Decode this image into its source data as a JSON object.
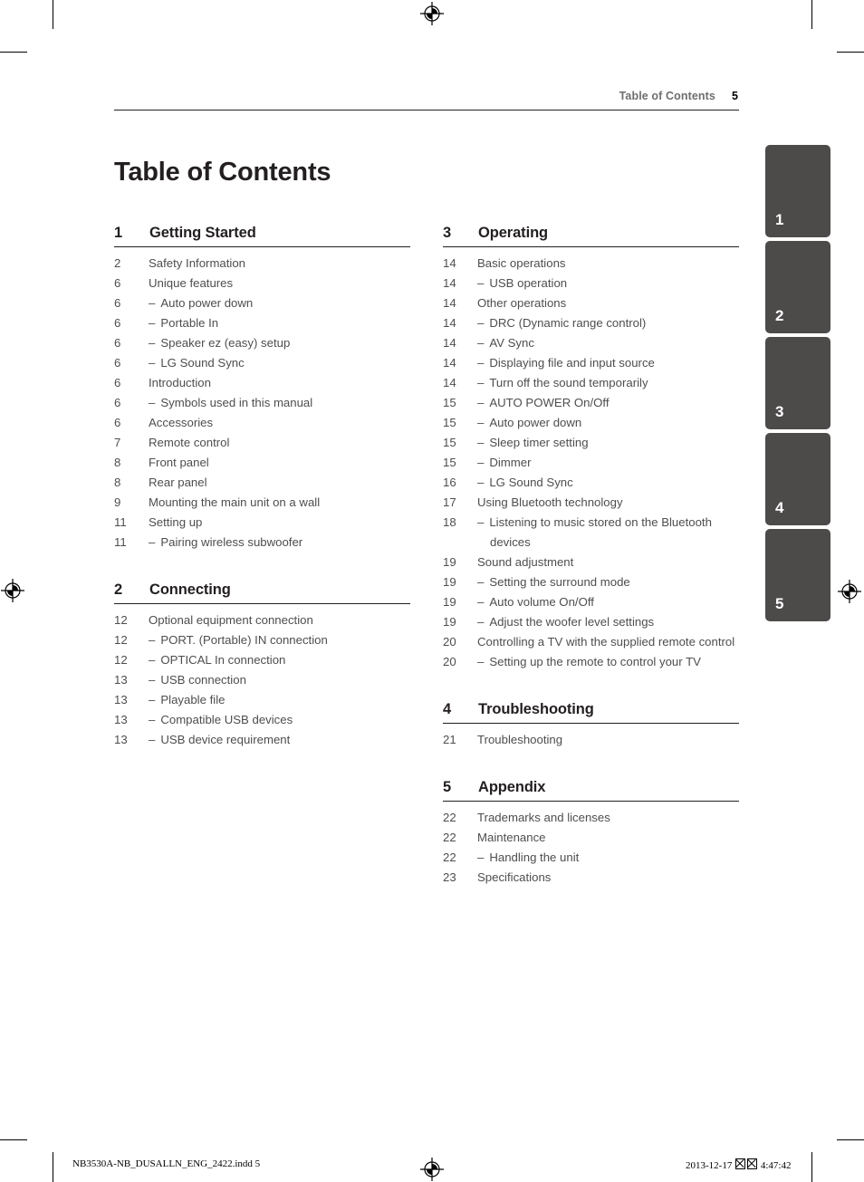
{
  "header": {
    "running_title": "Table of Contents",
    "page_number": "5"
  },
  "page_title": "Table of Contents",
  "columns": {
    "left": [
      {
        "number": "1",
        "title": "Getting Started",
        "entries": [
          {
            "page": "2",
            "label": "Safety Information",
            "sub": false
          },
          {
            "page": "6",
            "label": "Unique features",
            "sub": false
          },
          {
            "page": "6",
            "label": "Auto power down",
            "sub": true
          },
          {
            "page": "6",
            "label": "Portable In",
            "sub": true
          },
          {
            "page": "6",
            "label": "Speaker ez (easy) setup",
            "sub": true
          },
          {
            "page": "6",
            "label": "LG Sound Sync",
            "sub": true
          },
          {
            "page": "6",
            "label": "Introduction",
            "sub": false
          },
          {
            "page": "6",
            "label": "Symbols used in this manual",
            "sub": true
          },
          {
            "page": "6",
            "label": "Accessories",
            "sub": false
          },
          {
            "page": "7",
            "label": "Remote control",
            "sub": false
          },
          {
            "page": "8",
            "label": "Front panel",
            "sub": false
          },
          {
            "page": "8",
            "label": "Rear panel",
            "sub": false
          },
          {
            "page": "9",
            "label": "Mounting the main unit on a wall",
            "sub": false
          },
          {
            "page": "11",
            "label": "Setting up",
            "sub": false
          },
          {
            "page": "11",
            "label": "Pairing wireless subwoofer",
            "sub": true
          }
        ]
      },
      {
        "number": "2",
        "title": "Connecting",
        "entries": [
          {
            "page": "12",
            "label": "Optional equipment connection",
            "sub": false
          },
          {
            "page": "12",
            "label": "PORT. (Portable) IN connection",
            "sub": true
          },
          {
            "page": "12",
            "label": "OPTICAL In connection",
            "sub": true
          },
          {
            "page": "13",
            "label": "USB connection",
            "sub": true
          },
          {
            "page": "13",
            "label": "Playable file",
            "sub": true
          },
          {
            "page": "13",
            "label": "Compatible USB devices",
            "sub": true
          },
          {
            "page": "13",
            "label": "USB device requirement",
            "sub": true
          }
        ]
      }
    ],
    "right": [
      {
        "number": "3",
        "title": "Operating",
        "entries": [
          {
            "page": "14",
            "label": "Basic operations",
            "sub": false
          },
          {
            "page": "14",
            "label": "USB operation",
            "sub": true
          },
          {
            "page": "14",
            "label": "Other operations",
            "sub": false
          },
          {
            "page": "14",
            "label": "DRC (Dynamic range control)",
            "sub": true
          },
          {
            "page": "14",
            "label": "AV Sync",
            "sub": true
          },
          {
            "page": "14",
            "label": "Displaying file and input source",
            "sub": true
          },
          {
            "page": "14",
            "label": "Turn off the sound temporarily",
            "sub": true
          },
          {
            "page": "15",
            "label": "AUTO POWER On/Off",
            "sub": true
          },
          {
            "page": "15",
            "label": "Auto power down",
            "sub": true
          },
          {
            "page": "15",
            "label": "Sleep timer setting",
            "sub": true
          },
          {
            "page": "15",
            "label": "Dimmer",
            "sub": true
          },
          {
            "page": "16",
            "label": "LG Sound Sync",
            "sub": true
          },
          {
            "page": "17",
            "label": "Using Bluetooth technology",
            "sub": false
          },
          {
            "page": "18",
            "label": "Listening to music stored on the Bluetooth devices",
            "sub": true
          },
          {
            "page": "19",
            "label": "Sound adjustment",
            "sub": false
          },
          {
            "page": "19",
            "label": "Setting the surround mode",
            "sub": true
          },
          {
            "page": "19",
            "label": "Auto volume On/Off",
            "sub": true
          },
          {
            "page": "19",
            "label": "Adjust the woofer level settings",
            "sub": true
          },
          {
            "page": "20",
            "label": "Controlling a TV with the supplied remote control",
            "sub": false
          },
          {
            "page": "20",
            "label": "Setting up the remote to control your TV",
            "sub": true
          }
        ]
      },
      {
        "number": "4",
        "title": "Troubleshooting",
        "entries": [
          {
            "page": "21",
            "label": "Troubleshooting",
            "sub": false
          }
        ]
      },
      {
        "number": "5",
        "title": "Appendix",
        "entries": [
          {
            "page": "22",
            "label": "Trademarks and licenses",
            "sub": false
          },
          {
            "page": "22",
            "label": "Maintenance",
            "sub": false
          },
          {
            "page": "22",
            "label": "Handling the unit",
            "sub": true
          },
          {
            "page": "23",
            "label": "Specifications",
            "sub": false
          }
        ]
      }
    ]
  },
  "chapter_tabs": [
    "1",
    "2",
    "3",
    "4",
    "5"
  ],
  "footer": {
    "file_slug": "NB3530A-NB_DUSALLN_ENG_2422.indd   5",
    "date": "2013-12-17",
    "time": "4:47:42"
  },
  "colors": {
    "tab_fill": "#4d4a4a",
    "rule": "#231f20",
    "body_text": "#4e4e4e",
    "heading_text": "#231f20",
    "running_head_text": "#6e6e6e"
  },
  "dash": "–"
}
